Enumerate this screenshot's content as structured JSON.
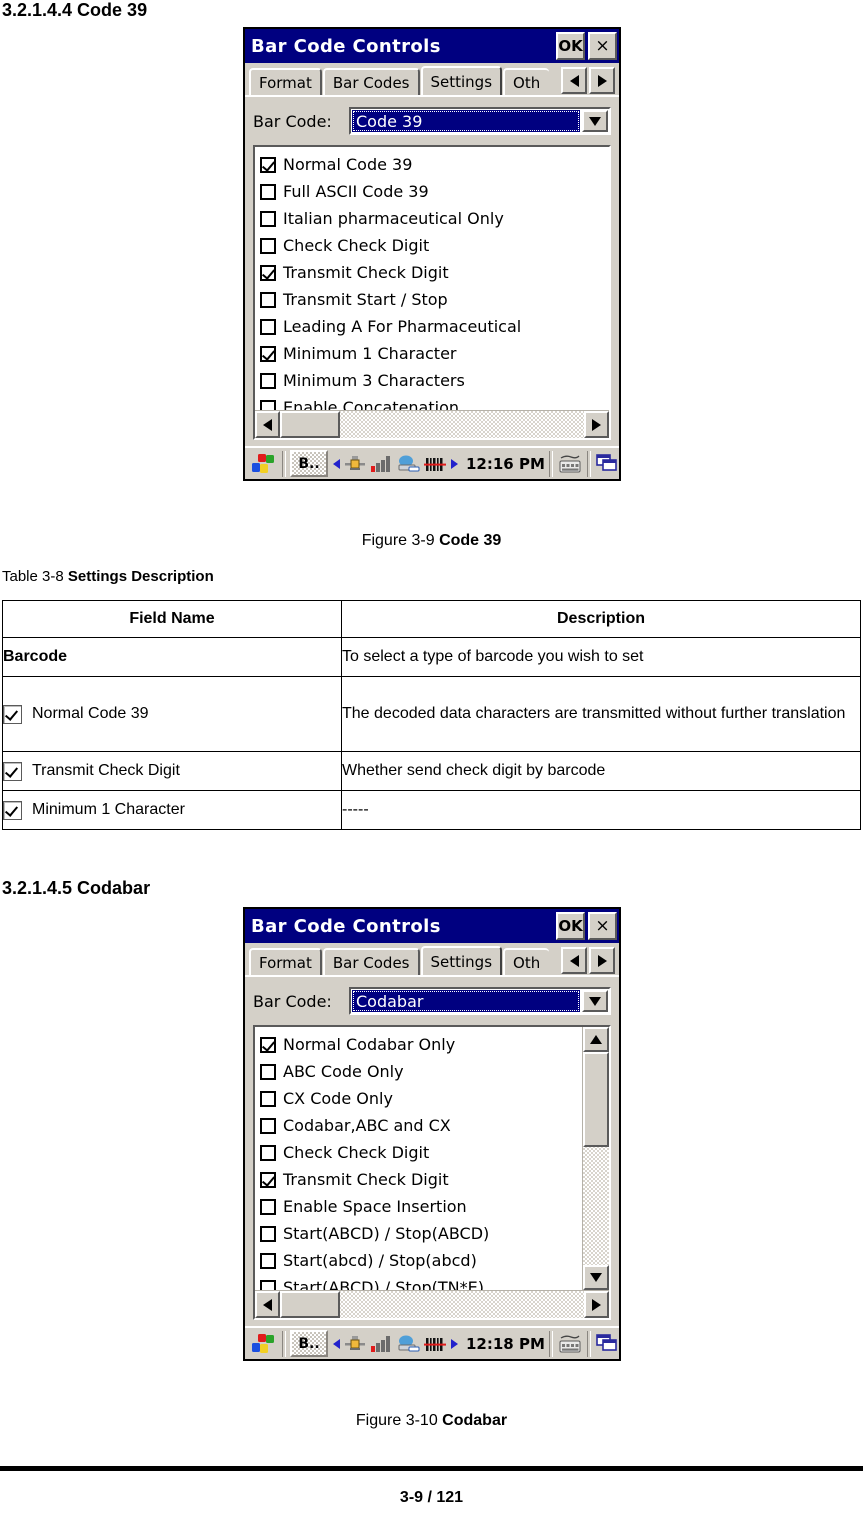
{
  "sections": {
    "code39": {
      "heading": "3.2.1.4.4 Code 39",
      "figure_caption_num": "Figure 3-9 ",
      "figure_caption_bold": "Code 39"
    },
    "codabar": {
      "heading": "3.2.1.4.5 Codabar",
      "figure_caption_num": "Figure 3-10 ",
      "figure_caption_bold": "Codabar"
    }
  },
  "table": {
    "label_prefix": "Table 3-8 ",
    "label_bold": "Settings Description",
    "headers": [
      "Field Name",
      "Description"
    ],
    "rows": [
      {
        "field": "Barcode",
        "checkbox": false,
        "bold": true,
        "description": "To select a type of barcode you wish to set",
        "tall": false
      },
      {
        "field": "Normal Code 39",
        "checkbox": true,
        "bold": false,
        "description": "The decoded data characters are transmitted without further translation",
        "tall": true
      },
      {
        "field": "Transmit Check Digit",
        "checkbox": true,
        "bold": false,
        "description": "Whether send check digit by barcode",
        "tall": false
      },
      {
        "field": "Minimum 1 Character",
        "checkbox": true,
        "bold": false,
        "description": "-----",
        "tall": false
      }
    ]
  },
  "dialog_code39": {
    "title": "Bar Code Controls",
    "ok_label": "OK",
    "close_label": "×",
    "tabs": [
      {
        "label": "Format",
        "active": false
      },
      {
        "label": "Bar Codes",
        "active": false
      },
      {
        "label": "Settings",
        "active": true
      },
      {
        "label": "Oth",
        "active": false,
        "clipped": true
      }
    ],
    "barcode_label": "Bar Code:",
    "barcode_value": "Code 39",
    "options": [
      {
        "label": "Normal Code 39",
        "checked": true
      },
      {
        "label": "Full ASCII Code 39",
        "checked": false
      },
      {
        "label": "Italian pharmaceutical Only",
        "checked": false
      },
      {
        "label": "Check Check Digit",
        "checked": false
      },
      {
        "label": "Transmit Check Digit",
        "checked": true
      },
      {
        "label": "Transmit Start / Stop",
        "checked": false
      },
      {
        "label": "Leading A For Pharmaceutical",
        "checked": false
      },
      {
        "label": "Minimum 1 Character",
        "checked": true
      },
      {
        "label": "Minimum 3 Characters",
        "checked": false
      },
      {
        "label": "Enable Concatenation",
        "checked": false
      }
    ],
    "has_vscroll": false,
    "taskbar": {
      "task_button_label": "B..",
      "time": "12:16 PM"
    }
  },
  "dialog_codabar": {
    "title": "Bar Code Controls",
    "ok_label": "OK",
    "close_label": "×",
    "tabs": [
      {
        "label": "Format",
        "active": false
      },
      {
        "label": "Bar Codes",
        "active": false
      },
      {
        "label": "Settings",
        "active": true
      },
      {
        "label": "Oth",
        "active": false,
        "clipped": true
      }
    ],
    "barcode_label": "Bar Code:",
    "barcode_value": "Codabar",
    "options": [
      {
        "label": "Normal Codabar Only",
        "checked": true
      },
      {
        "label": "ABC Code Only",
        "checked": false
      },
      {
        "label": "CX Code Only",
        "checked": false
      },
      {
        "label": "Codabar,ABC and CX",
        "checked": false
      },
      {
        "label": "Check Check Digit",
        "checked": false
      },
      {
        "label": "Transmit Check Digit",
        "checked": true
      },
      {
        "label": "Enable Space Insertion",
        "checked": false
      },
      {
        "label": "Start(ABCD) / Stop(ABCD)",
        "checked": false
      },
      {
        "label": "Start(abcd) / Stop(abcd)",
        "checked": false
      },
      {
        "label": "Start(ABCD) / Stop(TN*E)",
        "checked": false
      }
    ],
    "has_vscroll": true,
    "taskbar": {
      "task_button_label": "B..",
      "time": "12:18 PM"
    }
  },
  "footer": {
    "page": "3-9 / 121"
  },
  "colors": {
    "titlebar": "#000080",
    "window_face": "#d4d0c8",
    "selection": "#000080",
    "text": "#000000"
  },
  "icons": {
    "start": "windows-flag-icon",
    "tray_left_arrow": "arrow-left-icon",
    "tray_plug": "plug-icon",
    "tray_signal": "signal-bars-icon",
    "tray_network": "network-computer-icon",
    "tray_barcode": "barcode-scanner-icon",
    "tray_right_arrow": "arrow-right-icon",
    "tray_keyboard": "keyboard-icon",
    "tray_windows": "window-switch-icon"
  }
}
